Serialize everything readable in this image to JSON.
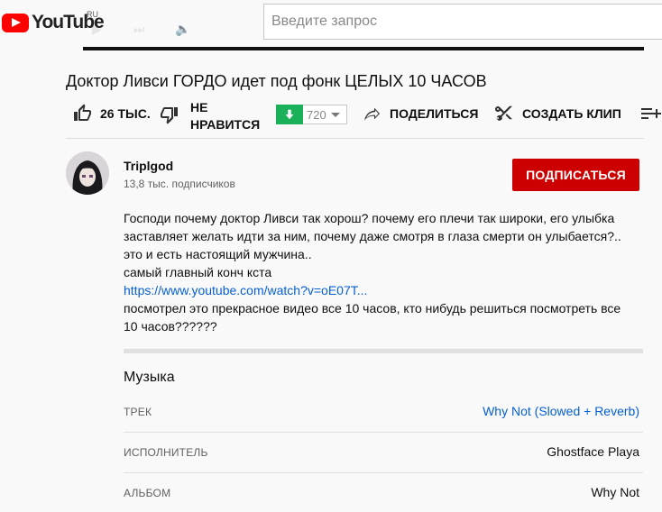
{
  "header": {
    "logo_text": "YouTube",
    "region": "RU",
    "search_placeholder": "Введите запрос"
  },
  "video": {
    "title": "Доктор Ливси ГОРДО идет под фонк ЦЕЛЫХ 10 ЧАСОВ"
  },
  "actions": {
    "like_count": "26 ТЫС.",
    "dislike_label_1": "НЕ",
    "dislike_label_2": "НРАВИТСЯ",
    "dislike_value": "720",
    "share_label": "ПОДЕЛИТЬСЯ",
    "clip_label": "СОЗДАТЬ КЛИП"
  },
  "channel": {
    "name": "Triplgod",
    "subscribers": "13,8 тыс. подписчиков",
    "subscribe_label": "ПОДПИСАТЬСЯ"
  },
  "description": {
    "line1": "Господи почему доктор Ливси так хорош? почему его плечи так широки, его улыбка",
    "line2": "заставляет желать идти за ним, почему даже смотря в глаза смерти он улыбается?..",
    "line3": "это и есть настоящий мужчина..",
    "line4": "самый главный конч кста",
    "link": "https://www.youtube.com/watch?v=oE07T...",
    "line5": "посмотрел это прекрасное видео все 10 часов, кто нибудь решиться посмотреть  все",
    "line6": "10 часов??????"
  },
  "music": {
    "title": "Музыка",
    "rows": [
      {
        "key": "ТРЕК",
        "value": "Why Not (Slowed + Reverb)"
      },
      {
        "key": "ИСПОЛНИТЕЛЬ",
        "value": "Ghostface Playa"
      },
      {
        "key": "АЛЬБОМ",
        "value": "Why Not"
      }
    ]
  },
  "colors": {
    "brand_red": "#ff0000",
    "subscribe_red": "#cc0000",
    "dislike_green": "#1bb05a",
    "link_blue": "#065fd4"
  }
}
